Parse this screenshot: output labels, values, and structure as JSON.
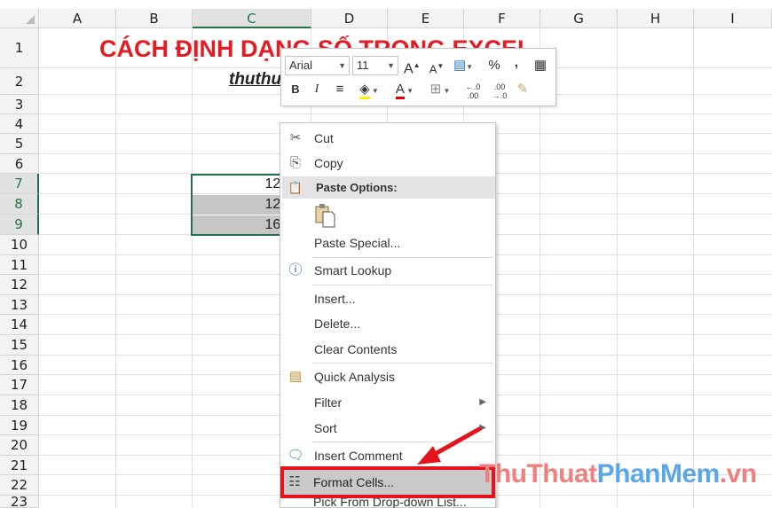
{
  "columns": [
    "A",
    "B",
    "C",
    "D",
    "E",
    "F",
    "G",
    "H",
    "I"
  ],
  "rows": [
    "1",
    "2",
    "3",
    "4",
    "5",
    "6",
    "7",
    "8",
    "9",
    "10",
    "11",
    "12",
    "13",
    "14",
    "15",
    "16",
    "17",
    "18",
    "19",
    "20",
    "21",
    "22",
    "23"
  ],
  "title": "CÁCH ĐỊNH DẠNG SỐ TRONG EXCEL",
  "subtitle": "thuthuatphanmem.vn",
  "cells": [
    "12334",
    "12475",
    "16412"
  ],
  "minibar": {
    "font_name": "Arial",
    "font_size": "11",
    "increase_font": "A",
    "decrease_font": "A",
    "percent": "%",
    "comma": ",",
    "bold": "B",
    "italic": "I",
    "font_color_letter": "A",
    "inc_decimal": "←.0 .00",
    "dec_decimal": ".00 →.0"
  },
  "context_menu": {
    "cut": "Cut",
    "copy": "Copy",
    "paste_options": "Paste Options:",
    "paste_special": "Paste Special...",
    "smart_lookup": "Smart Lookup",
    "insert": "Insert...",
    "delete": "Delete...",
    "clear_contents": "Clear Contents",
    "quick_analysis": "Quick Analysis",
    "filter": "Filter",
    "sort": "Sort",
    "insert_comment": "Insert Comment",
    "format_cells": "Format Cells...",
    "pick_from_list": "Pick From Drop-down List..."
  },
  "watermark": {
    "part1": "ThuThuat",
    "part2": "PhanMem",
    "part3": ".vn"
  },
  "colors": {
    "title_red": "#e31b23",
    "highlight_red": "#e3141c",
    "excel_green": "#217346"
  }
}
